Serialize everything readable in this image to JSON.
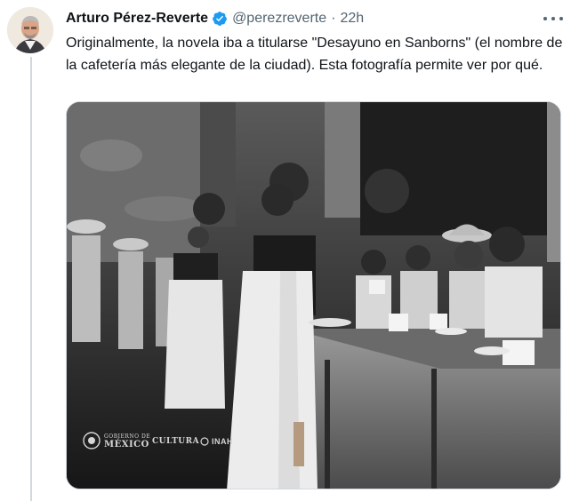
{
  "tweet": {
    "author_name": "Arturo Pérez-Reverte",
    "handle": "@perezreverte",
    "separator": "·",
    "time": "22h",
    "text": "Originalmente, la novela iba a titularse \"Desayuno en Sanborns\" (el nombre de la cafetería más elegante de la ciudad). Esta fotografía permite ver por qué."
  },
  "media": {
    "watermark_gobierno_line1": "GOBIERNO DE",
    "watermark_gobierno_line2": "MÉXICO",
    "watermark_cultura": "CULTURA",
    "watermark_inah": "INAH"
  },
  "icons": {
    "verified": "verified-badge-icon",
    "more": "more-options-icon",
    "avatar": "author-avatar"
  },
  "colors": {
    "verified_blue": "#1d9bf0",
    "secondary_text": "#536471",
    "primary_text": "#0f1419",
    "thread_line": "#cfd9de"
  }
}
